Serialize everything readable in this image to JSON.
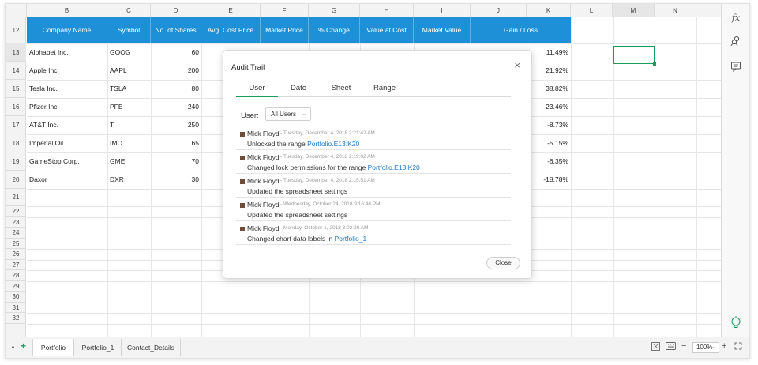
{
  "columns": [
    "B",
    "C",
    "D",
    "E",
    "F",
    "G",
    "H",
    "I",
    "J",
    "K",
    "L",
    "M",
    "N"
  ],
  "selected_column": "M",
  "rows": [
    "12",
    "13",
    "14",
    "15",
    "16",
    "17",
    "18",
    "19",
    "20",
    "21",
    "22",
    "23",
    "24",
    "25",
    "26",
    "27",
    "28",
    "29",
    "30",
    "31",
    "32"
  ],
  "table": {
    "headers": [
      "Company Name",
      "Symbol",
      "No. of Shares",
      "Avg. Cost Price",
      "Market Price",
      "% Change",
      "Value at Cost",
      "Market Value",
      "Gain / Loss"
    ],
    "rows": [
      {
        "company": "Alphabet Inc.",
        "symbol": "GOOG",
        "shares": "60",
        "gain": "11.49%"
      },
      {
        "company": "Apple Inc.",
        "symbol": "AAPL",
        "shares": "200",
        "gain": "21.92%"
      },
      {
        "company": "Tesla Inc.",
        "symbol": "TSLA",
        "shares": "80",
        "gain": "38.82%"
      },
      {
        "company": "Pfizer Inc.",
        "symbol": "PFE",
        "shares": "240",
        "gain": "23.46%"
      },
      {
        "company": "AT&T Inc.",
        "symbol": "T",
        "shares": "250",
        "gain": "-8.73%"
      },
      {
        "company": "Imperial Oil",
        "symbol": "IMO",
        "shares": "65",
        "gain": "-5.15%"
      },
      {
        "company": "GameStop Corp.",
        "symbol": "GME",
        "shares": "70",
        "gain": "-6.35%"
      },
      {
        "company": "Daxor",
        "symbol": "DXR",
        "shares": "30",
        "gain": "-18.78%"
      }
    ]
  },
  "right_panel": {
    "fx_label": "fx"
  },
  "sheets": {
    "tabs": [
      "Portfolio",
      "Portfolio_1",
      "Contact_Details"
    ],
    "active": "Portfolio",
    "add_label": "+",
    "zoom": "100%"
  },
  "dialog": {
    "title": "Audit Trail",
    "close_glyph": "×",
    "tabs": [
      "User",
      "Date",
      "Sheet",
      "Range"
    ],
    "active_tab": "User",
    "user_label": "User:",
    "user_value": "All Users",
    "entries": [
      {
        "name": "Mick Floyd",
        "time": "- Tuesday, December 4, 2018 2:21:42 AM",
        "msg": "Unlocked the range ",
        "link": "Portfolio.E13:K20"
      },
      {
        "name": "Mick Floyd",
        "time": "- Tuesday, December 4, 2018 2:19:02 AM",
        "msg": "Changed lock permissions for the range ",
        "link": "Portfolio.E13:K20"
      },
      {
        "name": "Mick Floyd",
        "time": "- Tuesday, December 4, 2018 2:15:51 AM",
        "msg": "Updated the spreadsheet settings",
        "link": ""
      },
      {
        "name": "Mick Floyd",
        "time": "- Wednesday, October 24, 2018 9:16:46 PM",
        "msg": "Updated the spreadsheet settings",
        "link": ""
      },
      {
        "name": "Mick Floyd",
        "time": "- Monday, October 1, 2018 3:02:36 AM",
        "msg": "Changed chart data labels in ",
        "link": "Portfolio_1"
      }
    ],
    "close_label": "Close"
  },
  "colors": {
    "header_blue": "#1e90d8",
    "selection_green": "#1b9c5c",
    "link_blue": "#1e78c8"
  }
}
